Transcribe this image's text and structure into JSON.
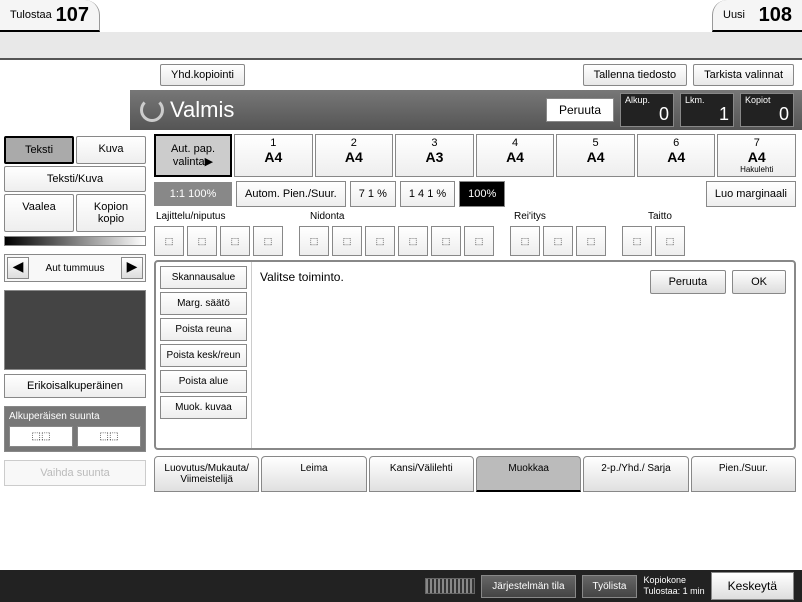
{
  "top": {
    "printLabel": "Tulostaa",
    "printNum": "107",
    "newLabel": "Uusi",
    "newNum": "108"
  },
  "header": {
    "combine": "Yhd.kopiointi",
    "save": "Tallenna tiedosto",
    "check": "Tarkista valinnat"
  },
  "status": {
    "text": "Valmis",
    "cancel": "Peruuta",
    "c1l": "Alkup.",
    "c1v": "0",
    "c2l": "Lkm.",
    "c2v": "1",
    "c3l": "Kopiot",
    "c3v": "0"
  },
  "modes": {
    "text": "Teksti",
    "photo": "Kuva",
    "textPhoto": "Teksti/Kuva",
    "pale": "Vaalea",
    "gen": "Kopion kopio"
  },
  "density": {
    "label": "Aut tummuus"
  },
  "preview": {
    "special": "Erikoisalkuperäinen"
  },
  "orient": {
    "title": "Alkuperäisen suunta",
    "b1": "⬚⬚",
    "b2": "⬚⬚",
    "change": "Vaihda suunta"
  },
  "trays": {
    "auto": "Aut. pap. valinta▶",
    "t": [
      {
        "n": "1",
        "s": "A4",
        "sub": ""
      },
      {
        "n": "2",
        "s": "A4",
        "sub": ""
      },
      {
        "n": "3",
        "s": "A3",
        "sub": ""
      },
      {
        "n": "4",
        "s": "A4",
        "sub": ""
      },
      {
        "n": "5",
        "s": "A4",
        "sub": ""
      },
      {
        "n": "6",
        "s": "A4",
        "sub": ""
      },
      {
        "n": "7",
        "s": "A4",
        "sub": "Hakulehti"
      }
    ]
  },
  "zoom": {
    "fixed": "1:1 100%",
    "auto": "Autom. Pien./Suur.",
    "p71": "7 1 %",
    "p141": "1 4 1 %",
    "p100": "100%",
    "margin": "Luo marginaali"
  },
  "finish": {
    "l1": "Lajittelu/niputus",
    "l2": "Nidonta",
    "l3": "Rei'itys",
    "l4": "Taitto"
  },
  "func": {
    "items": [
      "Skannausalue",
      "Marg. säätö",
      "Poista reuna",
      "Poista kesk/reun",
      "Poista alue",
      "Muok. kuvaa"
    ],
    "msg": "Valitse toiminto.",
    "cancel": "Peruuta",
    "ok": "OK"
  },
  "btabs": [
    "Luovutus/Mukauta/ Viimeistelijä",
    "Leima",
    "Kansi/Välilehti",
    "Muokkaa",
    "2-p./Yhd./ Sarja",
    "Pien./Suur."
  ],
  "footer": {
    "sys": "Järjestelmän tila",
    "jobs": "Työlista",
    "dev": "Kopiokone",
    "eta": "Tulostaa: 1 min",
    "interrupt": "Keskeytä"
  }
}
